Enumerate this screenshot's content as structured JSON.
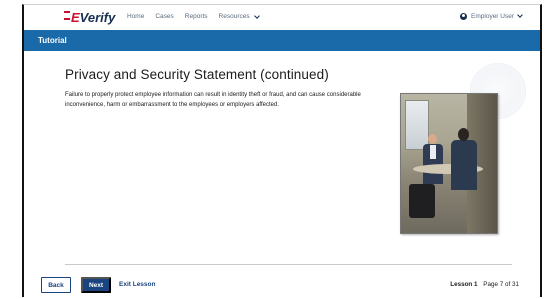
{
  "brand": {
    "logo_e": "E",
    "logo_text": "Verify"
  },
  "nav": {
    "items": [
      "Home",
      "Cases",
      "Reports",
      "Resources"
    ],
    "user_label": "Employer User"
  },
  "banner": {
    "title": "Tutorial"
  },
  "content": {
    "heading": "Privacy and Security Statement (continued)",
    "paragraph": "Failure to properly protect employee information can result in identity theft or fraud, and can cause considerable inconvenience, harm or embarrassment to the employees or employers affected."
  },
  "footer": {
    "back_label": "Back",
    "next_label": "Next",
    "exit_label": "Exit Lesson",
    "lesson_label": "Lesson 1",
    "page_label": "Page 7 of 31"
  },
  "colors": {
    "accent": "#1a6aaa",
    "primary": "#1a4480",
    "brand_red": "#c8102e"
  }
}
